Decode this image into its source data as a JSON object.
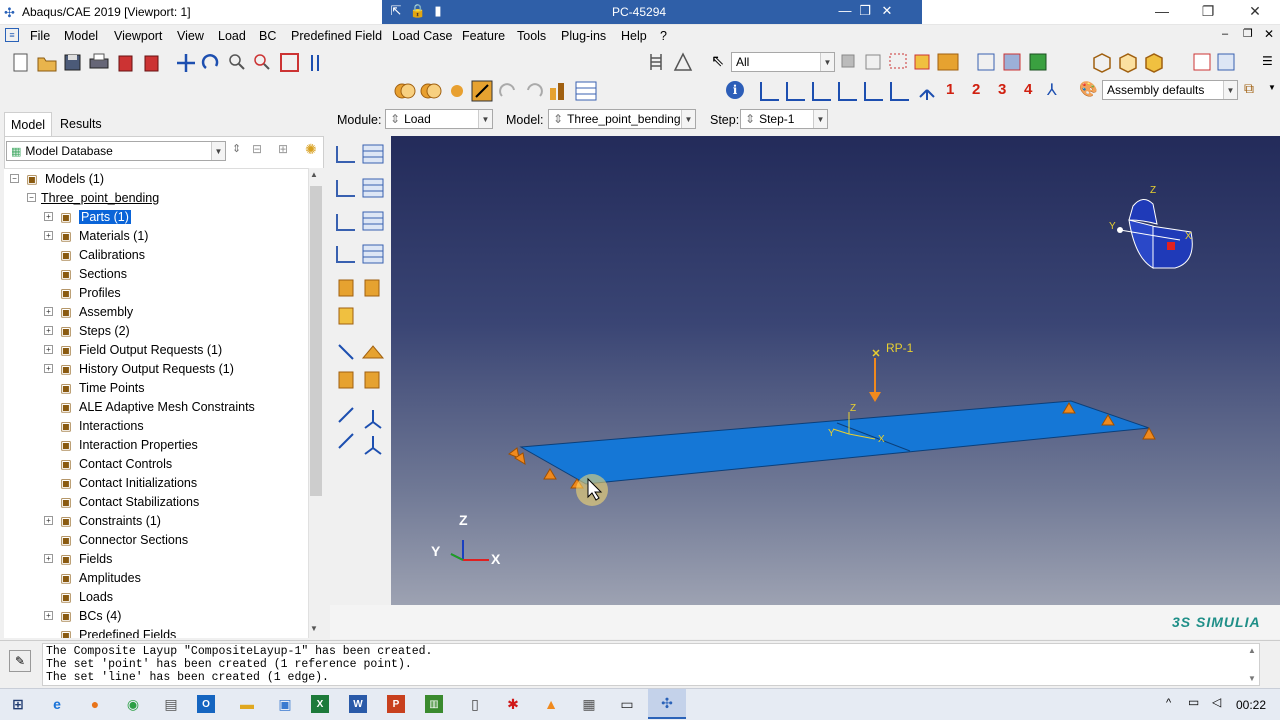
{
  "window": {
    "title": "Abaqus/CAE 2019 [Viewport: 1]",
    "remote_host": "PC-45294",
    "minimize_label": "—",
    "maximize_label": "❐",
    "close_label": "✕"
  },
  "menu": [
    "File",
    "Model",
    "Viewport",
    "View",
    "Load",
    "BC",
    "Predefined Field",
    "Load Case",
    "Feature",
    "Tools",
    "Plug-ins",
    "Help",
    "?"
  ],
  "menu_help_icon": "what's-this-icon",
  "toolbar": {
    "selection_filter": "All",
    "render_style": "Assembly defaults",
    "view_numbers": [
      "1",
      "2",
      "3",
      "4"
    ]
  },
  "context_bar": {
    "module_label": "Module:",
    "module_value": "Load",
    "model_label": "Model:",
    "model_value": "Three_point_bending",
    "step_label": "Step:",
    "step_value": "Step-1"
  },
  "tree": {
    "tabs": [
      "Model",
      "Results"
    ],
    "database": "Model Database",
    "items": [
      {
        "label": "Models (1)",
        "indent": 0,
        "expander": "−",
        "icon": "models-icon"
      },
      {
        "label": "Three_point_bending",
        "indent": 1,
        "expander": "−",
        "icon": ""
      },
      {
        "label": "Parts (1)",
        "indent": 2,
        "expander": "+",
        "icon": "parts-icon",
        "selected": true
      },
      {
        "label": "Materials (1)",
        "indent": 2,
        "expander": "+",
        "icon": "materials-icon"
      },
      {
        "label": "Calibrations",
        "indent": 2,
        "expander": "",
        "icon": "calibrations-icon"
      },
      {
        "label": "Sections",
        "indent": 2,
        "expander": "",
        "icon": "sections-icon"
      },
      {
        "label": "Profiles",
        "indent": 2,
        "expander": "",
        "icon": "profiles-icon"
      },
      {
        "label": "Assembly",
        "indent": 2,
        "expander": "+",
        "icon": "assembly-icon"
      },
      {
        "label": "Steps (2)",
        "indent": 2,
        "expander": "+",
        "icon": "steps-icon"
      },
      {
        "label": "Field Output Requests (1)",
        "indent": 2,
        "expander": "+",
        "icon": "field-output-icon"
      },
      {
        "label": "History Output Requests (1)",
        "indent": 2,
        "expander": "+",
        "icon": "history-output-icon"
      },
      {
        "label": "Time Points",
        "indent": 2,
        "expander": "",
        "icon": "time-points-icon"
      },
      {
        "label": "ALE Adaptive Mesh Constraints",
        "indent": 2,
        "expander": "",
        "icon": "ale-icon"
      },
      {
        "label": "Interactions",
        "indent": 2,
        "expander": "",
        "icon": "interactions-icon"
      },
      {
        "label": "Interaction Properties",
        "indent": 2,
        "expander": "",
        "icon": "interaction-properties-icon"
      },
      {
        "label": "Contact Controls",
        "indent": 2,
        "expander": "",
        "icon": "contact-controls-icon"
      },
      {
        "label": "Contact Initializations",
        "indent": 2,
        "expander": "",
        "icon": "contact-init-icon"
      },
      {
        "label": "Contact Stabilizations",
        "indent": 2,
        "expander": "",
        "icon": "contact-stab-icon"
      },
      {
        "label": "Constraints (1)",
        "indent": 2,
        "expander": "+",
        "icon": "constraints-icon"
      },
      {
        "label": "Connector Sections",
        "indent": 2,
        "expander": "",
        "icon": "connector-sections-icon"
      },
      {
        "label": "Fields",
        "indent": 2,
        "expander": "+",
        "icon": "fields-icon"
      },
      {
        "label": "Amplitudes",
        "indent": 2,
        "expander": "",
        "icon": "amplitudes-icon"
      },
      {
        "label": "Loads",
        "indent": 2,
        "expander": "",
        "icon": "loads-icon"
      },
      {
        "label": "BCs (4)",
        "indent": 2,
        "expander": "+",
        "icon": "bcs-icon"
      },
      {
        "label": "Predefined Fields",
        "indent": 2,
        "expander": "",
        "icon": "predefined-fields-icon"
      }
    ]
  },
  "viewport": {
    "reference_point_label": "RP-1",
    "triad_labels": {
      "z": "Z",
      "y": "Y",
      "x": "X"
    },
    "local_triad_labels": {
      "z": "Z",
      "y": "Y",
      "x": "X"
    },
    "view_cube_labels": {
      "z": "Z",
      "y": "Y",
      "x": "X"
    },
    "plate_color": "#1577d6",
    "bc_color": "#f08a1e",
    "load_color": "#f08a1e"
  },
  "brand": "3S SIMULIA",
  "messages": [
    "The Composite Layup \"CompositeLayup-1\" has been created.",
    "The set 'point' has been created (1 reference point).",
    "The set 'line' has been created (1 edge)."
  ],
  "taskbar": {
    "apps": [
      "start-icon",
      "edge-icon",
      "firefox-icon",
      "chrome-icon",
      "outlook-icon",
      "explorer-icon",
      "store-icon",
      "excel-icon",
      "word-icon",
      "powerpoint-icon",
      "project-icon",
      "file-icon",
      "acrobat-icon",
      "vlc-icon",
      "calculator-icon",
      "terminal-icon",
      "abaqus-icon"
    ],
    "clock": "00:22"
  }
}
